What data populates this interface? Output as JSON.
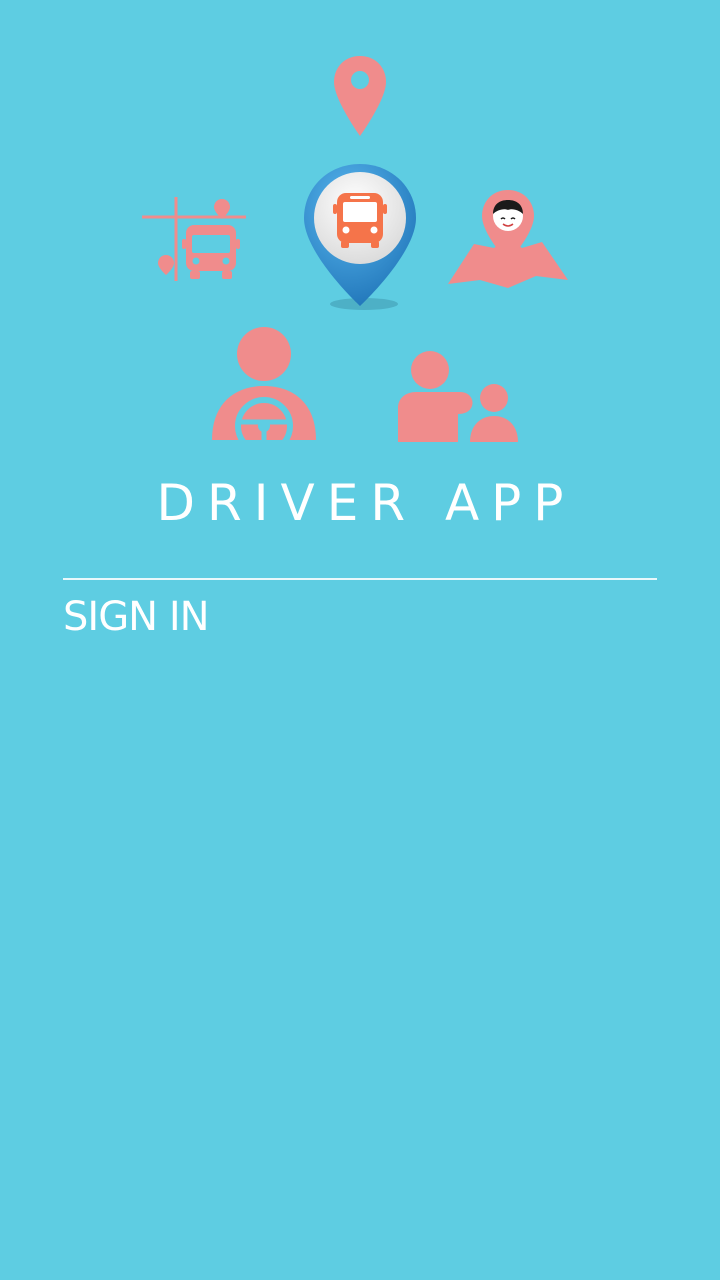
{
  "app": {
    "title": "DRIVER APP",
    "sign_in_label": "SIGN IN"
  },
  "illustration": {
    "icons": [
      "location-pin-icon",
      "bus-route-icon",
      "bus-location-pin-icon",
      "child-location-map-icon",
      "driver-steering-icon",
      "parent-child-icon"
    ]
  },
  "colors": {
    "background": "#5ecde2",
    "icon_pink": "#f08c8c",
    "bus_orange": "#f5744a",
    "pin_blue": "#2f8fcf",
    "text": "#ffffff"
  }
}
